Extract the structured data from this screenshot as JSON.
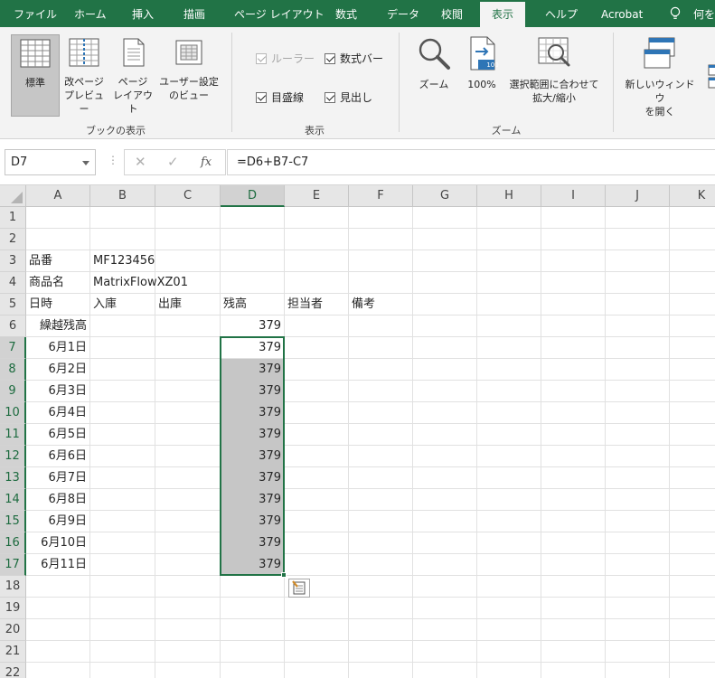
{
  "tabs": [
    "ファイル",
    "ホーム",
    "挿入",
    "描画",
    "ページ レイアウト",
    "数式",
    "データ",
    "校閲",
    "表示",
    "ヘルプ",
    "Acrobat",
    "何をし"
  ],
  "active_tab": "表示",
  "ribbon": {
    "workbook_views": {
      "label": "ブックの表示",
      "normal": "標準",
      "page_break_1": "改ページ",
      "page_break_2": "プレビュー",
      "page_layout_1": "ページ",
      "page_layout_2": "レイアウト",
      "custom_1": "ユーザー設定",
      "custom_2": "のビュー"
    },
    "show": {
      "label": "表示",
      "ruler": "ルーラー",
      "formula_bar": "数式バー",
      "gridlines": "目盛線",
      "headings": "見出し"
    },
    "zoom": {
      "label": "ズーム",
      "zoom": "ズーム",
      "hundred": "100%",
      "hundred_badge": "100",
      "sel_1": "選択範囲に合わせて",
      "sel_2": "拡大/縮小"
    },
    "window": {
      "new_1": "新しいウィンドウ",
      "new_2": "を開く"
    }
  },
  "formula_bar": {
    "name_box": "D7",
    "cancel": "✕",
    "enter": "✓",
    "fx": "fx",
    "formula": "=D6+B7-C7"
  },
  "columns": [
    "A",
    "B",
    "C",
    "D",
    "E",
    "F",
    "G",
    "H",
    "I",
    "J",
    "K"
  ],
  "selected_column": "D",
  "rows": [
    "1",
    "2",
    "3",
    "4",
    "5",
    "6",
    "7",
    "8",
    "9",
    "10",
    "11",
    "12",
    "13",
    "14",
    "15",
    "16",
    "17",
    "18",
    "19",
    "20",
    "21",
    "22"
  ],
  "selected_rows": [
    "7",
    "8",
    "9",
    "10",
    "11",
    "12",
    "13",
    "14",
    "15",
    "16",
    "17"
  ],
  "cells": {
    "A3": "品番",
    "B3": "MF123456",
    "A4": "商品名",
    "B4": "MatrixFlowXZ01",
    "A5": "日時",
    "B5": "入庫",
    "C5": "出庫",
    "D5": "残高",
    "E5": "担当者",
    "F5": "備考",
    "A6": "繰越残高",
    "D6": "379",
    "A7": "6月1日",
    "D7": "379",
    "A8": "6月2日",
    "D8": "379",
    "A9": "6月3日",
    "D9": "379",
    "A10": "6月4日",
    "D10": "379",
    "A11": "6月5日",
    "D11": "379",
    "A12": "6月6日",
    "D12": "379",
    "A13": "6月7日",
    "D13": "379",
    "A14": "6月8日",
    "D14": "379",
    "A15": "6月9日",
    "D15": "379",
    "A16": "6月10日",
    "D16": "379",
    "A17": "6月11日",
    "D17": "379"
  },
  "colors": {
    "accent": "#217346",
    "selection_fill": "#c6c6c6",
    "header_bg": "#e6e6e6"
  }
}
